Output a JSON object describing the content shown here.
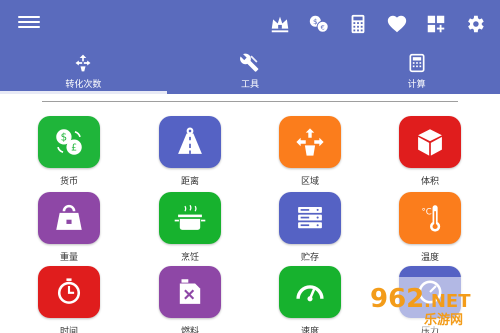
{
  "topbar": {
    "background": "#5a6bbd",
    "icons": [
      "menu-icon",
      "crown-icon",
      "currency-exchange-icon",
      "calculator-icon",
      "heart-icon",
      "add-widget-icon",
      "settings-icon"
    ]
  },
  "tabs": [
    {
      "label": "转化次数",
      "icon": "convert-icon",
      "active": true
    },
    {
      "label": "工具",
      "icon": "tools-icon",
      "active": false
    },
    {
      "label": "计算",
      "icon": "calculator-icon",
      "active": false
    }
  ],
  "categories": [
    {
      "label": "货币",
      "icon": "currency-icon",
      "color": "#1fb53a"
    },
    {
      "label": "距离",
      "icon": "road-icon",
      "color": "#5562c4"
    },
    {
      "label": "区域",
      "icon": "area-icon",
      "color": "#fb7d1c"
    },
    {
      "label": "体积",
      "icon": "cube-icon",
      "color": "#e01d1d"
    },
    {
      "label": "重量",
      "icon": "weight-icon",
      "color": "#8e47a6"
    },
    {
      "label": "烹饪",
      "icon": "cooking-pot-icon",
      "color": "#17b22e"
    },
    {
      "label": "贮存",
      "icon": "storage-icon",
      "color": "#5562c4"
    },
    {
      "label": "温度",
      "icon": "thermometer-icon",
      "color": "#fb7d1c"
    },
    {
      "label": "时间",
      "icon": "clock-icon",
      "color": "#e01d1d"
    },
    {
      "label": "燃料",
      "icon": "fuel-icon",
      "color": "#8e47a6"
    },
    {
      "label": "速度",
      "icon": "speedometer-icon",
      "color": "#17b22e"
    },
    {
      "label": "压力",
      "icon": "pressure-icon",
      "color": "#5562c4"
    }
  ],
  "watermark": {
    "text": "962.NET",
    "subtext": "乐游网"
  }
}
